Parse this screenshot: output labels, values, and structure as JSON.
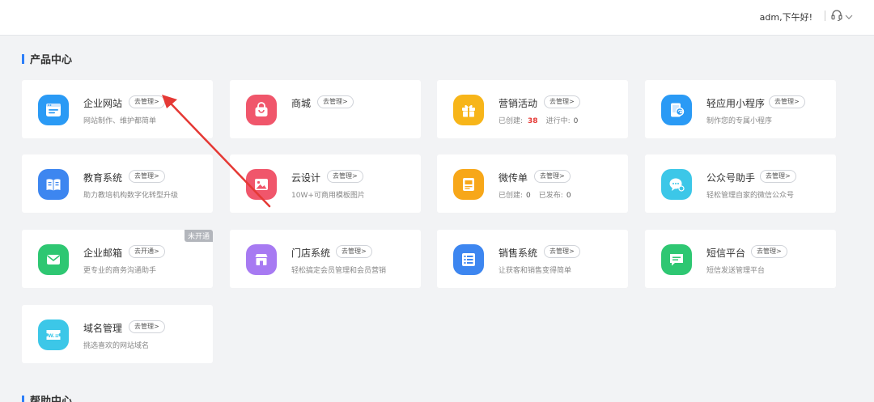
{
  "header": {
    "greeting": "adm,下午好!"
  },
  "sections": {
    "product_center": "产品中心",
    "help_center": "帮助中心"
  },
  "colors": {
    "accent": "#2d7ff9",
    "annotation_arrow": "#e53935"
  },
  "cards": [
    {
      "name": "企业网站",
      "manage": "去管理>",
      "desc": "网站制作、维护都简单",
      "icon": "website-icon",
      "color": "#2a9af5"
    },
    {
      "name": "商城",
      "manage": "去管理>",
      "desc": "",
      "icon": "shop-bag-icon",
      "color": "#f0566b"
    },
    {
      "name": "营销活动",
      "manage": "去管理>",
      "desc_created_label": "已创建:",
      "desc_created_value": "38",
      "desc_running_label": "进行中:",
      "desc_running_value": "0",
      "icon": "gift-icon",
      "color": "#f7b519"
    },
    {
      "name": "轻应用小程序",
      "manage": "去管理>",
      "desc": "制作您的专属小程序",
      "icon": "mini-program-icon",
      "color": "#2a9af5"
    },
    {
      "name": "教育系统",
      "manage": "去管理>",
      "desc": "助力教培机构数字化转型升级",
      "icon": "book-icon",
      "color": "#3d86f0"
    },
    {
      "name": "云设计",
      "manage": "去管理>",
      "desc": "10W+可商用模板图片",
      "icon": "image-icon",
      "color": "#f0566b"
    },
    {
      "name": "微传单",
      "manage": "去管理>",
      "desc_created_label": "已创建:",
      "desc_created_value": "0",
      "desc_published_label": "已发布:",
      "desc_published_value": "0",
      "icon": "flyer-icon",
      "color": "#f7a719"
    },
    {
      "name": "公众号助手",
      "manage": "去管理>",
      "desc": "轻松管理自家的微信公众号",
      "icon": "chat-bubble-icon",
      "color": "#3cc7e8"
    },
    {
      "name": "企业邮箱",
      "manage": "去开通>",
      "desc": "更专业的商务沟通助手",
      "ribbon": "未开通",
      "icon": "mail-icon",
      "color": "#2ec772"
    },
    {
      "name": "门店系统",
      "manage": "去管理>",
      "desc": "轻松搞定会员管理和会员营销",
      "icon": "store-icon",
      "color": "#a77af2"
    },
    {
      "name": "销售系统",
      "manage": "去管理>",
      "desc": "让获客和销售变得简单",
      "icon": "list-icon",
      "color": "#3d86f0"
    },
    {
      "name": "短信平台",
      "manage": "去管理>",
      "desc": "短信发送管理平台",
      "icon": "sms-icon",
      "color": "#2ec772"
    },
    {
      "name": "域名管理",
      "manage": "去管理>",
      "desc": "挑选喜欢的网站域名",
      "icon": "domain-icon",
      "color": "#3cc7e8"
    }
  ]
}
